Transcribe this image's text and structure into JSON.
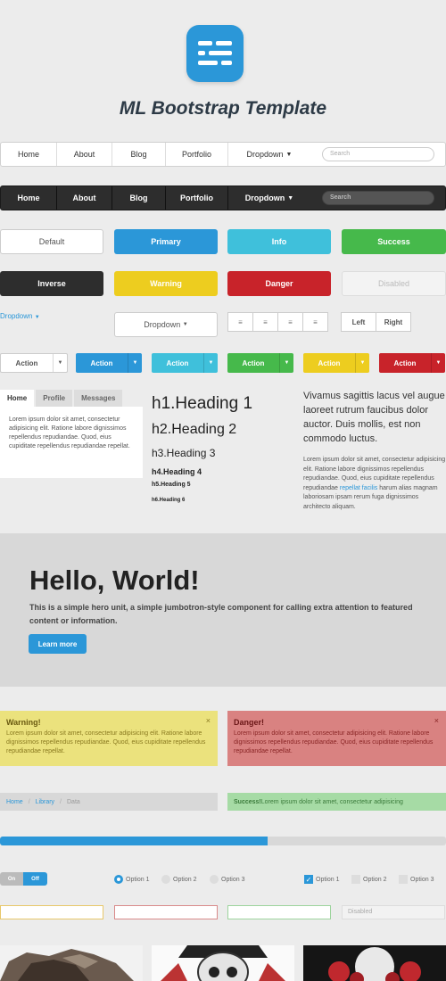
{
  "title": "ML Bootstrap Template",
  "nav": {
    "items": [
      "Home",
      "About",
      "Blog",
      "Portfolio",
      "Dropdown"
    ],
    "search_placeholder": "Search"
  },
  "buttons": {
    "default": "Default",
    "primary": "Primary",
    "info": "Info",
    "success": "Success",
    "inverse": "Inverse",
    "warning": "Warning",
    "danger": "Danger",
    "disabled": "Disabled"
  },
  "dropdown_link": "Dropdown",
  "dropdown_button": "Dropdown",
  "segmented": {
    "left": "Left",
    "right": "Right"
  },
  "split_action": "Action",
  "tabs": {
    "labels": [
      "Home",
      "Profile",
      "Messages"
    ],
    "body": "Lorem ipsum dolor sit amet, consectetur adipisicing elit. Ratione labore dignissimos repellendus repudiandae. Quod, eius cupiditate repellendus repudiandae repellat."
  },
  "headings": {
    "h1": "h1.Heading 1",
    "h2": "h2.Heading 2",
    "h3": "h3.Heading 3",
    "h4": "h4.Heading 4",
    "h5": "h5.Heading 5",
    "h6": "h6.Heading 6"
  },
  "lead": "Vivamus sagittis lacus vel augue laoreet rutrum faucibus dolor auctor. Duis mollis, est non commodo luctus.",
  "paragraph": {
    "before": "Lorem ipsum dolor sit amet, consectetur adipisicing elit. Ratione labore dignissimos repellendus repudiandae. Quod, eius cupiditate repellendus repudiandae ",
    "link": "repellat facilis",
    "after": " harum alias magnam laboriosam ipsam rerum fuga dignissimos architecto aliquam."
  },
  "jumbotron": {
    "title": "Hello, World!",
    "text": "This is a simple hero unit, a simple jumbotron-style component for calling extra attention to featured content or information.",
    "button": "Learn more"
  },
  "alerts": {
    "warning_title": "Warning!",
    "danger_title": "Danger!",
    "body": "Lorem ipsum dolor sit amet, consectetur adipisicing elit. Ratione labore dignissimos repellendus repudiandae. Quod, eius cupiditate repellendus repudiandae repellat.",
    "close": "×",
    "success_strong": "Success!",
    "success_text": " Lorem ipsum dolor sit amet, consectetur adipisicing"
  },
  "breadcrumb": [
    "Home",
    "Library",
    "Data"
  ],
  "progress": 0.6,
  "toggle": {
    "on": "On",
    "off": "Off"
  },
  "radios": [
    "Option 1",
    "Option 2",
    "Option 3"
  ],
  "checkboxes": [
    "Option 1",
    "Option 2",
    "Option 3"
  ],
  "input_disabled": "Disabled",
  "colors": {
    "primary": "#2b97d8",
    "info": "#3fc0db",
    "success": "#46b94b",
    "warning": "#edcd1f",
    "danger": "#c8232a",
    "inverse": "#2d2d2d"
  }
}
